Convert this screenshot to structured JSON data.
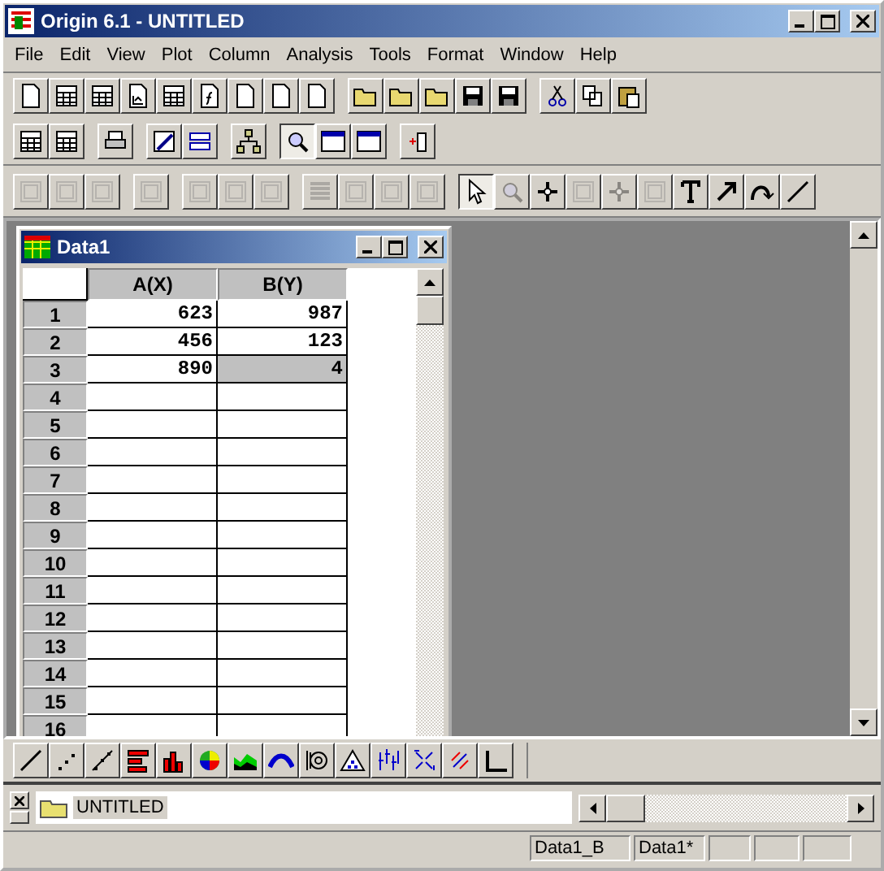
{
  "window": {
    "title": "Origin 6.1 - UNTITLED"
  },
  "menu": [
    "File",
    "Edit",
    "View",
    "Plot",
    "Column",
    "Analysis",
    "Tools",
    "Format",
    "Window",
    "Help"
  ],
  "toolbar_rows": [
    {
      "groups": [
        [
          {
            "pressed": false,
            "disabled": false
          },
          {
            "pressed": false,
            "disabled": false
          },
          {
            "pressed": false,
            "disabled": false
          },
          {
            "pressed": false,
            "disabled": false
          },
          {
            "pressed": false,
            "disabled": false
          },
          {
            "pressed": false,
            "disabled": false
          },
          {
            "pressed": false,
            "disabled": false
          },
          {
            "pressed": false,
            "disabled": false
          },
          {
            "pressed": false,
            "disabled": false
          }
        ],
        [
          {
            "pressed": false,
            "disabled": false
          },
          {
            "pressed": false,
            "disabled": false
          },
          {
            "pressed": false,
            "disabled": false
          },
          {
            "pressed": false,
            "disabled": false
          },
          {
            "pressed": false,
            "disabled": false
          }
        ],
        [
          {
            "pressed": false,
            "disabled": false
          },
          {
            "pressed": false,
            "disabled": false
          },
          {
            "pressed": false,
            "disabled": false
          }
        ]
      ]
    },
    {
      "groups": [
        [
          {
            "pressed": false,
            "disabled": false
          },
          {
            "pressed": false,
            "disabled": false
          }
        ],
        [
          {
            "pressed": false,
            "disabled": false
          }
        ],
        [
          {
            "pressed": false,
            "disabled": false
          },
          {
            "pressed": false,
            "disabled": false
          }
        ],
        [
          {
            "pressed": false,
            "disabled": false
          }
        ],
        [
          {
            "pressed": true,
            "disabled": false
          },
          {
            "pressed": false,
            "disabled": false
          },
          {
            "pressed": false,
            "disabled": false
          }
        ],
        [
          {
            "pressed": false,
            "disabled": false
          }
        ]
      ]
    },
    {
      "groups": [
        [
          {
            "pressed": false,
            "disabled": true
          },
          {
            "pressed": false,
            "disabled": true
          },
          {
            "pressed": false,
            "disabled": true
          }
        ],
        [
          {
            "pressed": false,
            "disabled": true
          }
        ],
        [
          {
            "pressed": false,
            "disabled": true
          },
          {
            "pressed": false,
            "disabled": true
          },
          {
            "pressed": false,
            "disabled": true
          }
        ],
        [
          {
            "pressed": false,
            "disabled": true
          },
          {
            "pressed": false,
            "disabled": true
          },
          {
            "pressed": false,
            "disabled": true
          },
          {
            "pressed": false,
            "disabled": true
          }
        ],
        [
          {
            "pressed": true,
            "disabled": false
          },
          {
            "pressed": false,
            "disabled": true
          },
          {
            "pressed": false,
            "disabled": false
          },
          {
            "pressed": false,
            "disabled": true
          },
          {
            "pressed": false,
            "disabled": true
          },
          {
            "pressed": false,
            "disabled": true
          },
          {
            "pressed": false,
            "disabled": false
          },
          {
            "pressed": false,
            "disabled": false
          },
          {
            "pressed": false,
            "disabled": false
          },
          {
            "pressed": false,
            "disabled": false
          }
        ]
      ]
    }
  ],
  "worksheet": {
    "title": "Data1",
    "columns": [
      "A(X)",
      "B(Y)"
    ],
    "rows": [
      {
        "label": "1",
        "cells": [
          {
            "value": "623",
            "selected": false
          },
          {
            "value": "987",
            "selected": false
          }
        ]
      },
      {
        "label": "2",
        "cells": [
          {
            "value": "456",
            "selected": false
          },
          {
            "value": "123",
            "selected": false
          }
        ]
      },
      {
        "label": "3",
        "cells": [
          {
            "value": "890",
            "selected": false
          },
          {
            "value": "4",
            "selected": true
          }
        ]
      },
      {
        "label": "4",
        "cells": [
          {
            "selected": false
          },
          {
            "selected": false
          }
        ]
      },
      {
        "label": "5",
        "cells": [
          {
            "selected": false
          },
          {
            "selected": false
          }
        ]
      },
      {
        "label": "6",
        "cells": [
          {
            "selected": false
          },
          {
            "selected": false
          }
        ]
      },
      {
        "label": "7",
        "cells": [
          {
            "selected": false
          },
          {
            "selected": false
          }
        ]
      },
      {
        "label": "8",
        "cells": [
          {
            "selected": false
          },
          {
            "selected": false
          }
        ]
      },
      {
        "label": "9",
        "cells": [
          {
            "selected": false
          },
          {
            "selected": false
          }
        ]
      },
      {
        "label": "10",
        "cells": [
          {
            "selected": false
          },
          {
            "selected": false
          }
        ]
      },
      {
        "label": "11",
        "cells": [
          {
            "selected": false
          },
          {
            "selected": false
          }
        ]
      },
      {
        "label": "12",
        "cells": [
          {
            "selected": false
          },
          {
            "selected": false
          }
        ]
      },
      {
        "label": "13",
        "cells": [
          {
            "selected": false
          },
          {
            "selected": false
          }
        ]
      },
      {
        "label": "14",
        "cells": [
          {
            "selected": false
          },
          {
            "selected": false
          }
        ]
      },
      {
        "label": "15",
        "cells": [
          {
            "selected": false
          },
          {
            "selected": false
          }
        ]
      },
      {
        "label": "16",
        "cells": [
          {
            "selected": false
          },
          {
            "selected": false
          }
        ]
      }
    ]
  },
  "plot_toolbar": [
    {
      "pressed": false
    },
    {
      "pressed": false
    },
    {
      "pressed": false
    },
    {
      "pressed": false
    },
    {
      "pressed": false
    },
    {
      "pressed": false
    },
    {
      "pressed": false
    },
    {
      "pressed": false
    },
    {
      "pressed": false
    },
    {
      "pressed": false
    },
    {
      "pressed": false
    },
    {
      "pressed": false
    },
    {
      "pressed": false
    },
    {
      "pressed": false
    }
  ],
  "project_explorer": {
    "folder": "UNTITLED"
  },
  "status_bar": [
    "Data1_B",
    "Data1*"
  ]
}
